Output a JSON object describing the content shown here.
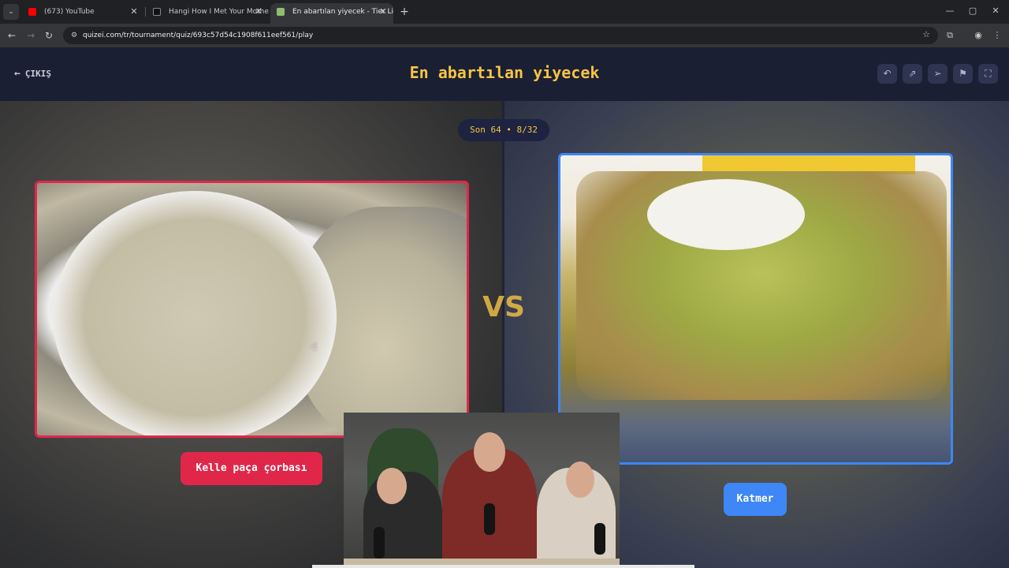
{
  "browser": {
    "tabs": [
      {
        "label": "(673) YouTube",
        "color": "#ff0000"
      },
      {
        "label": "Hangi How I Met Your Mother",
        "color": "#000000"
      },
      {
        "label": "En abartılan yiyecek - Tier List, ",
        "color": "#8fbf6a"
      }
    ],
    "url": "quizei.com/tr/tournament/quiz/693c57d54c1908f611eef561/play",
    "window_controls": {
      "minimize": "—",
      "maximize": "▢",
      "close": "✕"
    }
  },
  "header": {
    "exit_label": "ÇIKIŞ",
    "title": "En abartılan yiyecek",
    "buttons": [
      "undo-icon",
      "share-icon",
      "send-icon",
      "flag-icon",
      "fullscreen-icon"
    ]
  },
  "round": {
    "label": "Son 64 • 8/32"
  },
  "vs": {
    "label": "VS"
  },
  "left_option": {
    "name": "Kelle paça çorbası",
    "accent": "#e0274a"
  },
  "right_option": {
    "name": "Katmer",
    "accent": "#3f86f6"
  },
  "colors": {
    "title": "#f6c544",
    "header_bg": "#1b1f33"
  }
}
